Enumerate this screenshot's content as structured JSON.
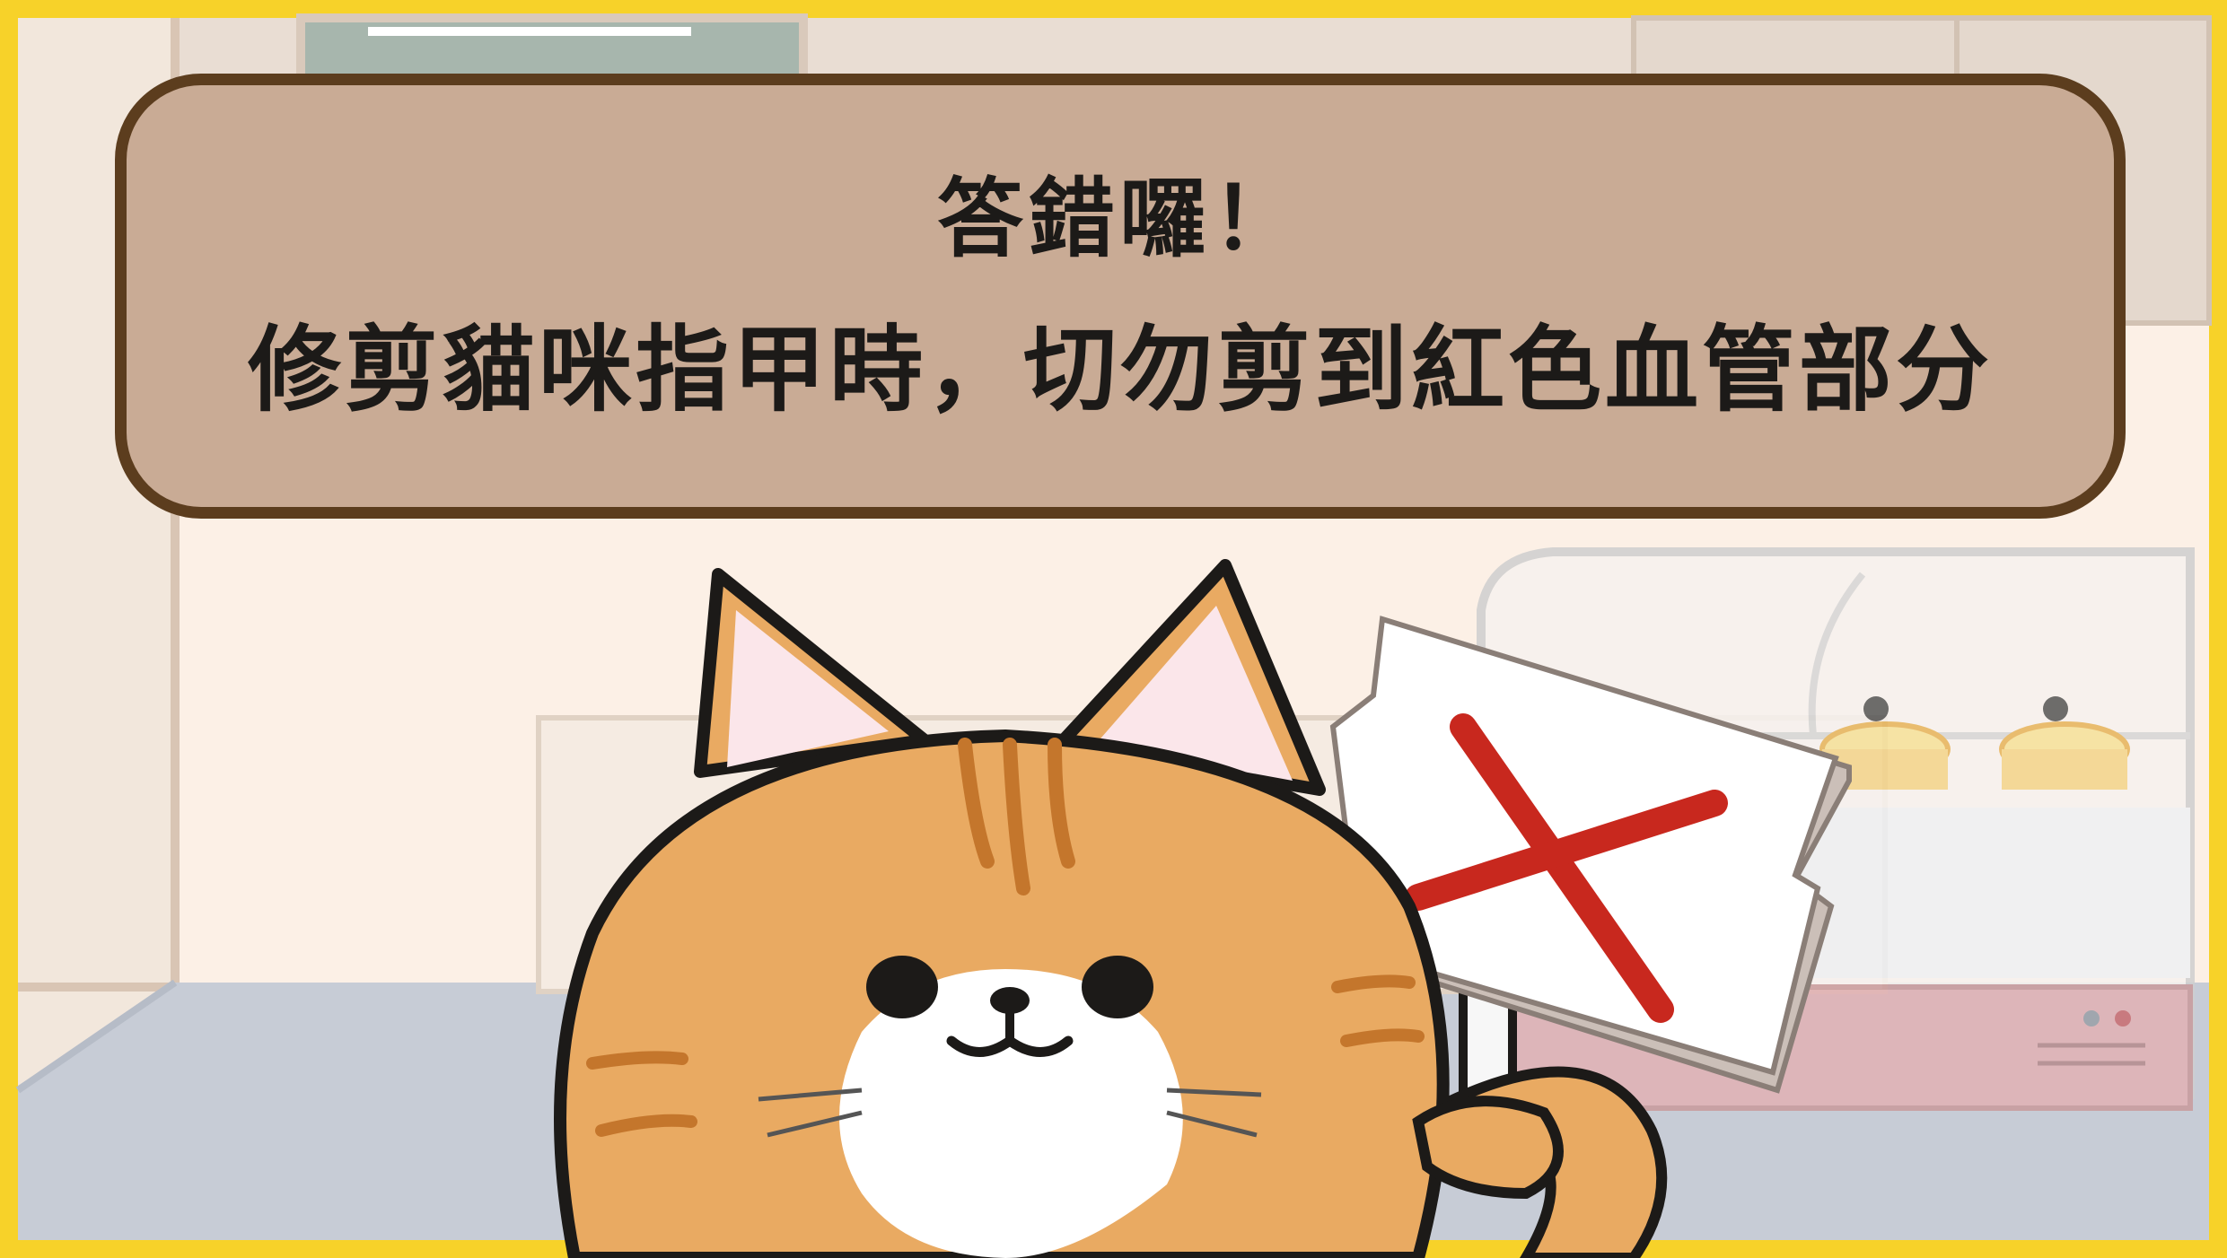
{
  "dialog": {
    "title": "答錯囉！",
    "message": "修剪貓咪指甲時，切勿剪到紅色血管部分"
  },
  "scene": {
    "character": "orange-tabby-cat",
    "sign_mark": "red-cross",
    "background": "cafe-with-dessert-display-case"
  },
  "colors": {
    "frame": "#f7d229",
    "bubble_fill": "#c9ab95",
    "bubble_border": "#5c3d1e",
    "cat_fur": "#e9aa62",
    "cat_stripes": "#c4762c",
    "cross": "#c8281e",
    "outline": "#1c1a18"
  }
}
